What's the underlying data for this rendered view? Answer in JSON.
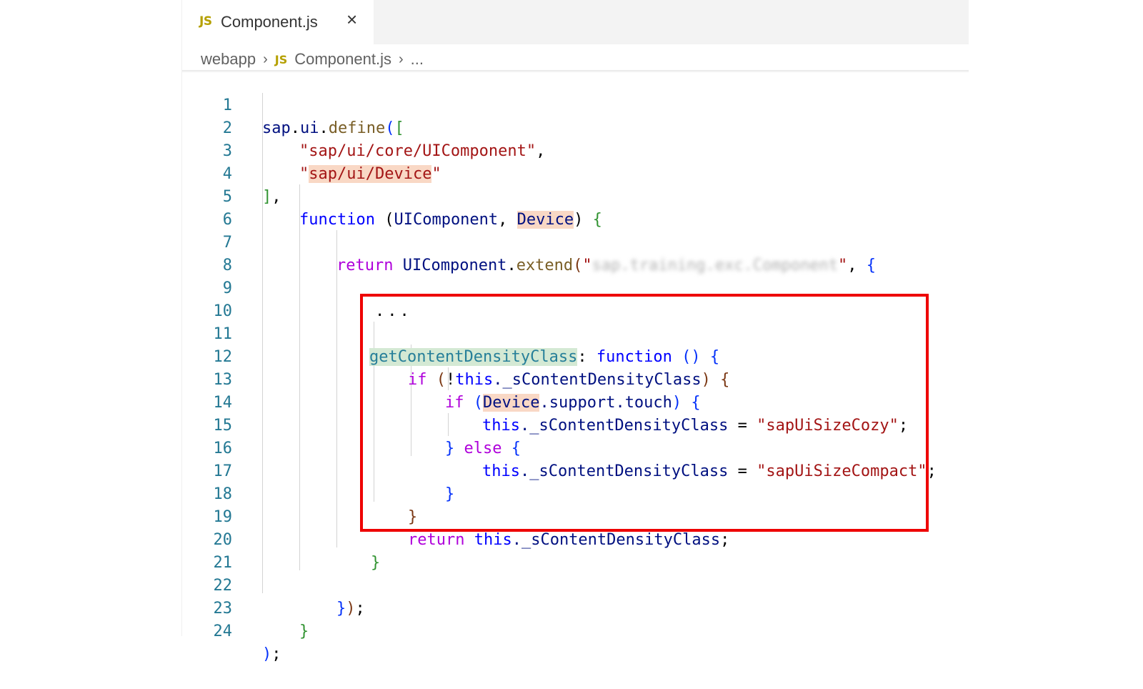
{
  "tab": {
    "lang_badge": "JS",
    "filename": "Component.js"
  },
  "breadcrumb": {
    "folder": "webapp",
    "lang_badge": "JS",
    "file": "Component.js",
    "more": "..."
  },
  "code": {
    "line_numbers": [
      "1",
      "2",
      "3",
      "4",
      "5",
      "6",
      "7",
      "8",
      "9",
      "10",
      "11",
      "12",
      "13",
      "14",
      "15",
      "16",
      "17",
      "18",
      "19",
      "20",
      "21",
      "22",
      "23",
      "24"
    ],
    "l1": {
      "a": "sap",
      "b": ".",
      "c": "ui",
      "d": ".",
      "e": "define",
      "f": "(",
      "g": "["
    },
    "l2": {
      "s": "\"sap/ui/core/UIComponent\"",
      "p": ","
    },
    "l3": {
      "q1": "\"",
      "s": "sap/ui/Device",
      "q2": "\""
    },
    "l4": {
      "a": "]",
      "b": ","
    },
    "l5": {
      "kw": "function",
      "p1": " (",
      "a1": "UIComponent",
      "c": ", ",
      "a2": "Device",
      "p2": ")",
      "sp": " ",
      "b": "{"
    },
    "l7": {
      "kw": "return",
      "sp": " ",
      "obj": "UIComponent",
      "dot": ".",
      "fn": "extend",
      "p": "(",
      "q1": "\"",
      "hidden": "sap.training.exc.Component",
      "q2": "\"",
      "c": ", ",
      "b": "{"
    },
    "l9": {
      "ellipsis": "..."
    },
    "l11": {
      "name": "getContentDensityClass",
      "colon": ": ",
      "kw": "function",
      "sp": " ",
      "paren": "()",
      "sp2": " ",
      "b": "{"
    },
    "l12": {
      "kw": "if",
      "sp": " ",
      "p1": "(",
      "not": "!",
      "this": "this",
      "prop": "._sContentDensityClass",
      "p2": ")",
      "sp2": " ",
      "b": "{"
    },
    "l13": {
      "kw": "if",
      "sp": " ",
      "p1": "(",
      "obj": "Device",
      "rest": ".support.touch",
      "p2": ")",
      "sp2": " ",
      "b": "{"
    },
    "l14": {
      "this": "this",
      "prop": "._sContentDensityClass",
      "op": " = ",
      "s": "\"sapUiSizeCozy\"",
      "semi": ";"
    },
    "l15": {
      "b1": "}",
      "sp": " ",
      "kw": "else",
      "sp2": " ",
      "b2": "{"
    },
    "l16": {
      "this": "this",
      "prop": "._sContentDensityClass",
      "op": " = ",
      "s": "\"sapUiSizeCompact\"",
      "semi": ";"
    },
    "l17": {
      "b": "}"
    },
    "l18": {
      "b": "}"
    },
    "l19": {
      "kw": "return",
      "sp": " ",
      "this": "this",
      "prop": "._sContentDensityClass",
      "semi": ";"
    },
    "l20": {
      "b": "}"
    },
    "l22": {
      "b": "}",
      "p": ")",
      "semi": ";"
    },
    "l23": {
      "b": "}"
    },
    "l24": {
      "p": ")",
      "semi": ";"
    }
  },
  "colors": {
    "highlight_box": "#ee0000",
    "keyword": "#0000ff",
    "control": "#af00db",
    "string": "#a31515",
    "line_number": "#237893"
  }
}
